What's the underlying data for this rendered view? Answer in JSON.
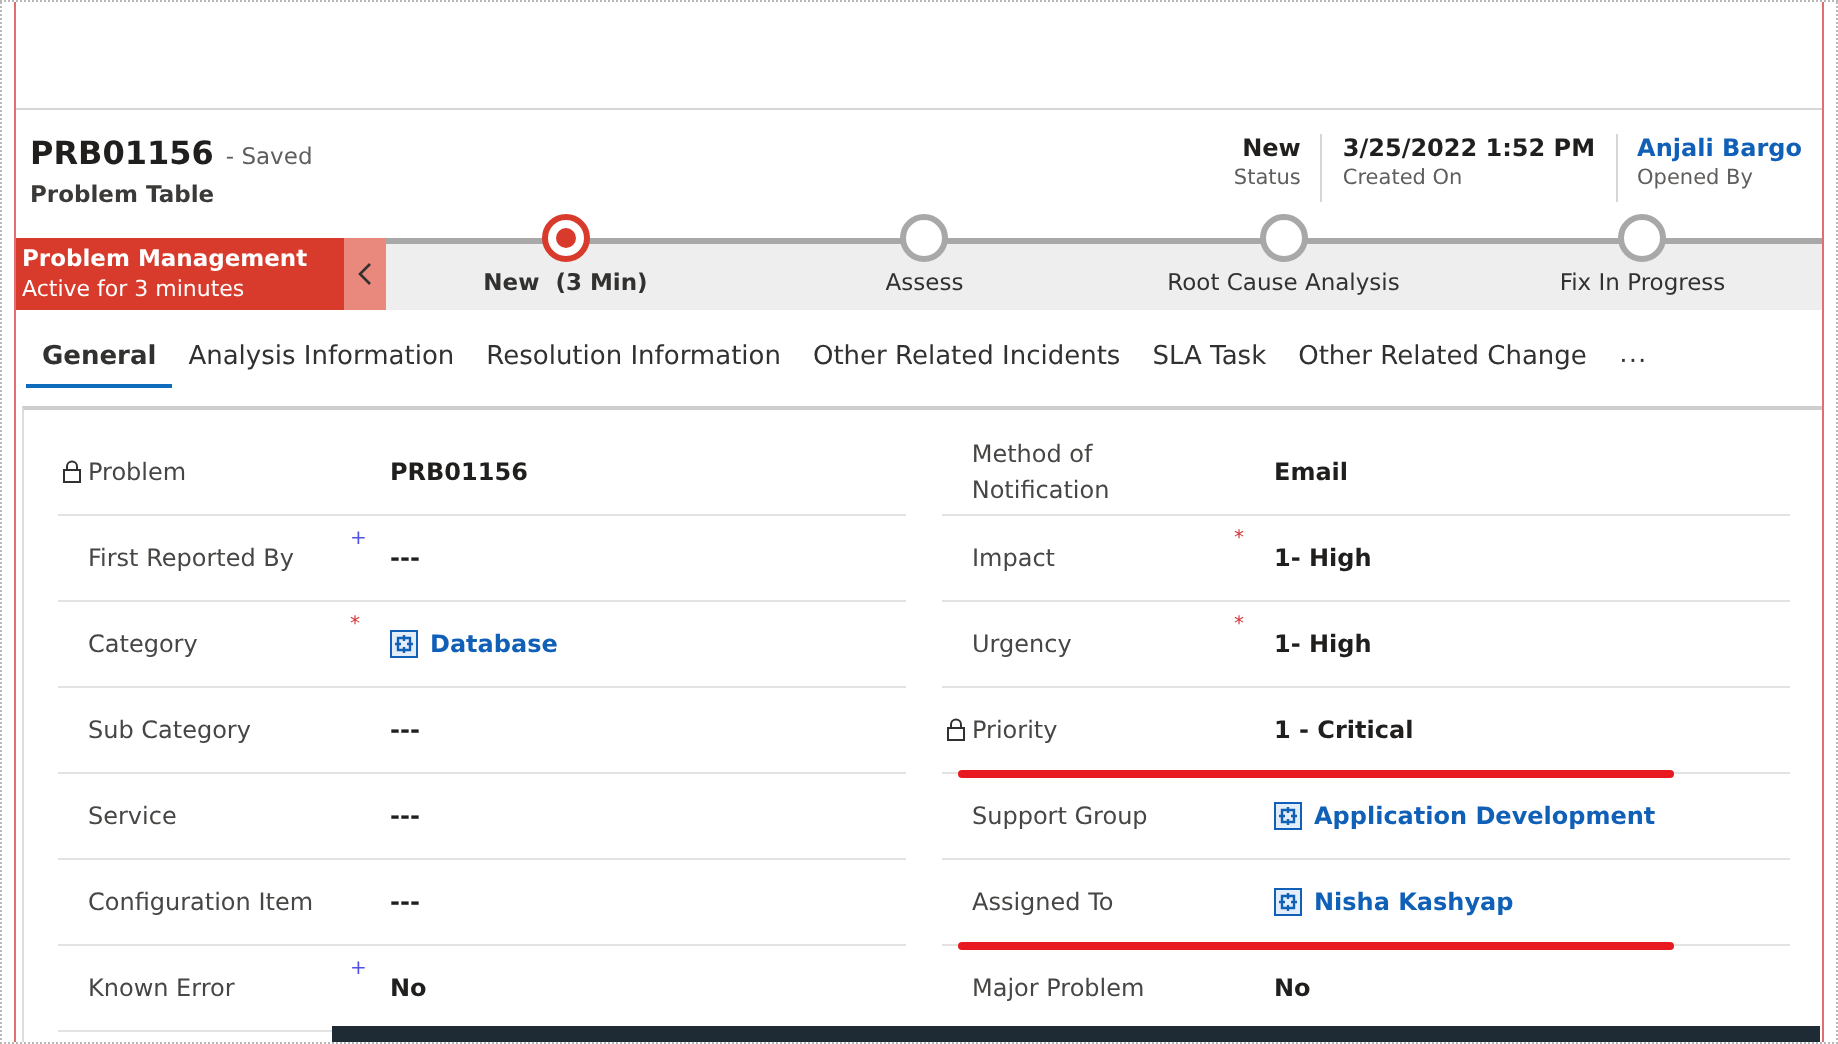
{
  "header": {
    "record_id": "PRB01156",
    "save_state": "- Saved",
    "entity": "Problem Table",
    "fields": [
      {
        "value": "New",
        "label": "Status",
        "kind": "text"
      },
      {
        "value": "3/25/2022 1:52 PM",
        "label": "Created On",
        "kind": "text"
      },
      {
        "value": "Anjali Bargo",
        "label": "Opened By",
        "kind": "link"
      }
    ]
  },
  "process": {
    "name": "Problem Management",
    "duration": "Active for 3 minutes",
    "stages": [
      {
        "label": "New  (3 Min)",
        "selected": true
      },
      {
        "label": "Assess",
        "selected": false
      },
      {
        "label": "Root Cause Analysis",
        "selected": false
      },
      {
        "label": "Fix In Progress",
        "selected": false
      }
    ]
  },
  "tabs": [
    {
      "label": "General",
      "selected": true
    },
    {
      "label": "Analysis Information",
      "selected": false
    },
    {
      "label": "Resolution Information",
      "selected": false
    },
    {
      "label": "Other Related Incidents",
      "selected": false
    },
    {
      "label": "SLA Task",
      "selected": false
    },
    {
      "label": "Other Related Change",
      "selected": false
    }
  ],
  "tabs_more": "···",
  "form": {
    "left": [
      {
        "label": "Problem",
        "locked": true,
        "value": "PRB01156",
        "kind": "text",
        "annotated": false
      },
      {
        "label": "First Reported By",
        "locked": false,
        "marker": {
          "text": "+",
          "kind": "recommended"
        },
        "value": "---",
        "kind": "text",
        "annotated": false
      },
      {
        "label": "Category",
        "locked": false,
        "marker": {
          "text": "*",
          "kind": "required"
        },
        "value": "Database",
        "kind": "lookup",
        "annotated": false
      },
      {
        "label": "Sub Category",
        "locked": false,
        "value": "---",
        "kind": "text",
        "annotated": false
      },
      {
        "label": "Service",
        "locked": false,
        "value": "---",
        "kind": "text",
        "annotated": false
      },
      {
        "label": "Configuration Item",
        "locked": false,
        "value": "---",
        "kind": "text",
        "annotated": false
      },
      {
        "label": "Known Error",
        "locked": false,
        "marker": {
          "text": "+",
          "kind": "recommended"
        },
        "value": "No",
        "kind": "text",
        "annotated": false
      }
    ],
    "right": [
      {
        "label": "Method of Notification",
        "locked": false,
        "value": "Email",
        "kind": "text",
        "annotated": false
      },
      {
        "label": "Impact",
        "locked": false,
        "marker": {
          "text": "*",
          "kind": "required"
        },
        "value": "1- High",
        "kind": "text",
        "annotated": false
      },
      {
        "label": "Urgency",
        "locked": false,
        "marker": {
          "text": "*",
          "kind": "required"
        },
        "value": "1- High",
        "kind": "text",
        "annotated": false
      },
      {
        "label": "Priority",
        "locked": true,
        "value": "1 - Critical",
        "kind": "text",
        "annotated": true
      },
      {
        "label": "Support Group",
        "locked": false,
        "value": "Application Development",
        "kind": "lookup",
        "annotated": false
      },
      {
        "label": "Assigned To",
        "locked": false,
        "value": "Nisha Kashyap",
        "kind": "lookup",
        "annotated": true
      },
      {
        "label": "Major Problem",
        "locked": false,
        "value": "No",
        "kind": "text",
        "annotated": false
      }
    ]
  }
}
